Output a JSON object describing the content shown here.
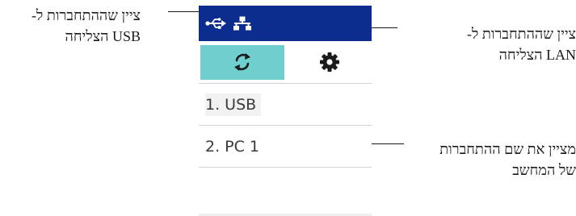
{
  "device": {
    "status_bar": {
      "usb_icon": "usb-icon",
      "lan_icon": "lan-network-icon",
      "color": "#0d2d8e"
    },
    "tabs": [
      {
        "icon": "sync-arrows-icon",
        "active": true,
        "color": "#6fcfcf"
      },
      {
        "icon": "gear-icon",
        "active": false
      }
    ],
    "connections": [
      {
        "label": "1. USB"
      },
      {
        "label": "2. PC 1"
      }
    ]
  },
  "callouts": {
    "usb": {
      "line1": "ציין שההתחברות ל-",
      "line2": "USB הצליחה"
    },
    "lan": {
      "line1": "ציין שההתחברות ל-",
      "line2": "LAN הצליחה"
    },
    "pc_name": {
      "line1": "מציין את שם ההתחברות",
      "line2": "של המחשב"
    }
  }
}
